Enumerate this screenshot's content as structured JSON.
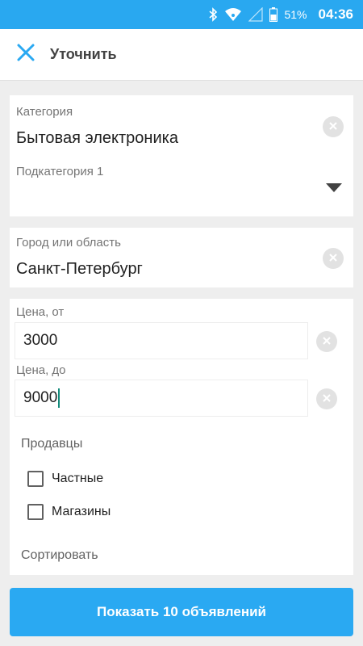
{
  "colors": {
    "status_bar": "#29a8f0",
    "accent": "#2aa9f2",
    "close_icon": "#2aa9f2",
    "caret": "#138a7a"
  },
  "status_bar": {
    "icons": [
      "bluetooth-icon",
      "wifi-icon",
      "cellular-signal-icon",
      "battery-icon"
    ],
    "battery": "51%",
    "time": "04:36"
  },
  "toolbar": {
    "close_icon": "close-icon",
    "title": "Уточнить"
  },
  "category": {
    "label": "Категория",
    "value": "Бытовая электроника",
    "clear_icon": "clear-icon",
    "subcategory_label": "Подкатегория 1",
    "subcategory_value": "",
    "dropdown_icon": "dropdown-arrow-icon"
  },
  "location": {
    "label": "Город или область",
    "value": "Санкт-Петербург",
    "clear_icon": "clear-icon"
  },
  "price": {
    "from_label": "Цена, от",
    "from_value": "3000",
    "to_label": "Цена, до",
    "to_value": "9000",
    "clear_icon": "clear-icon"
  },
  "sellers": {
    "title": "Продавцы",
    "options": [
      {
        "label": "Частные",
        "checked": false
      },
      {
        "label": "Магазины",
        "checked": false
      }
    ]
  },
  "sort": {
    "title": "Сортировать"
  },
  "submit": {
    "label": "Показать 10 объявлений"
  }
}
